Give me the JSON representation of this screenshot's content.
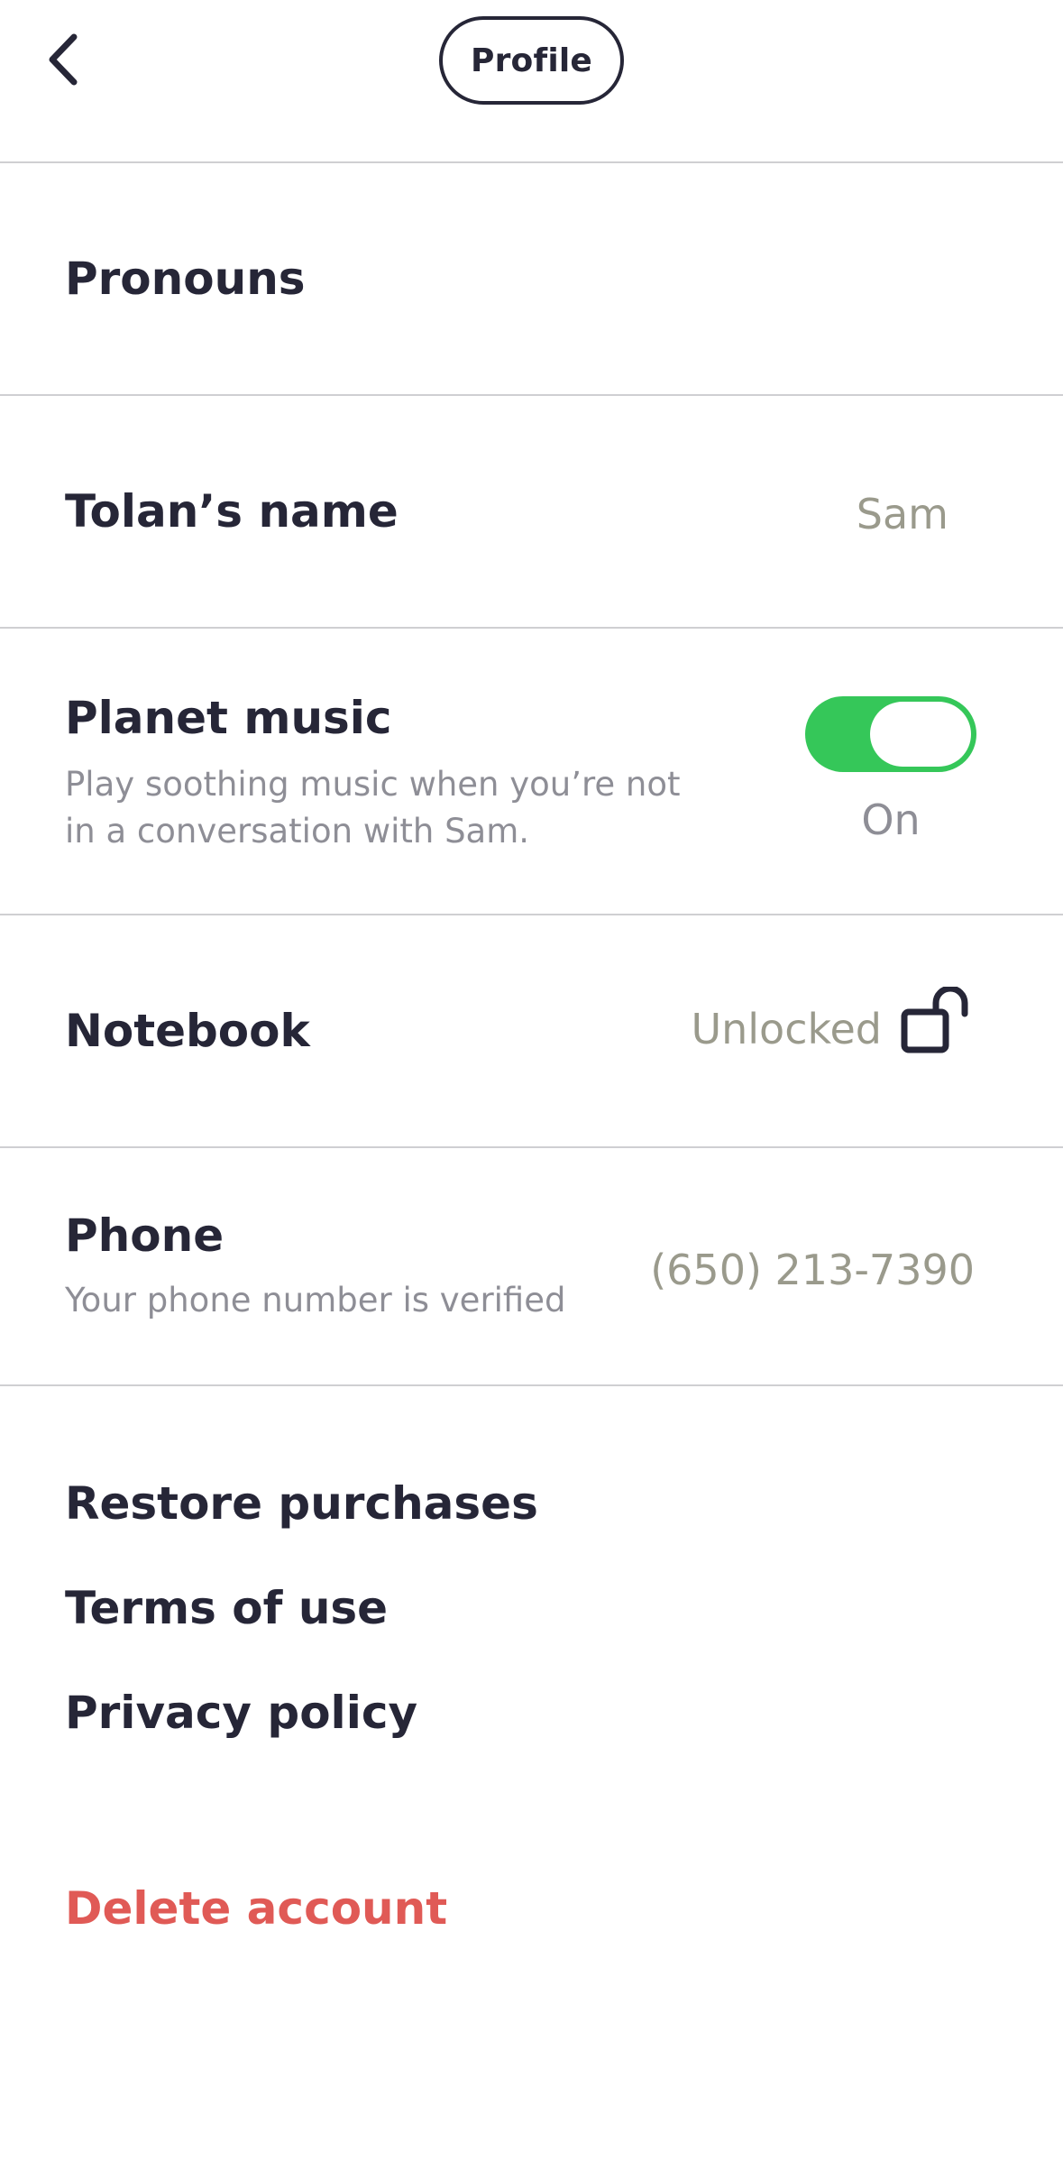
{
  "header": {
    "title": "Profile",
    "back_icon": "chevron-left-icon"
  },
  "rows": {
    "pronouns": {
      "label": "Pronouns"
    },
    "tolan_name": {
      "label": "Tolan’s name",
      "value": "Sam"
    },
    "planet_music": {
      "label": "Planet music",
      "description": "Play soothing music when you’re not in a conversation with Sam.",
      "toggle_state": "On",
      "toggle_on": true
    },
    "notebook": {
      "label": "Notebook",
      "value": "Unlocked",
      "icon": "unlocked-padlock-icon"
    },
    "phone": {
      "label": "Phone",
      "description": "Your phone number is verified",
      "value": "(650) 213-7390"
    }
  },
  "links": {
    "restore": "Restore purchases",
    "terms": "Terms of use",
    "privacy": "Privacy policy",
    "delete": "Delete account"
  },
  "colors": {
    "text": "#262637",
    "muted": "#8e8e96",
    "value": "#9a9a8c",
    "toggle_on": "#35c759",
    "danger": "#e05a56",
    "divider": "#cfcfd2"
  }
}
